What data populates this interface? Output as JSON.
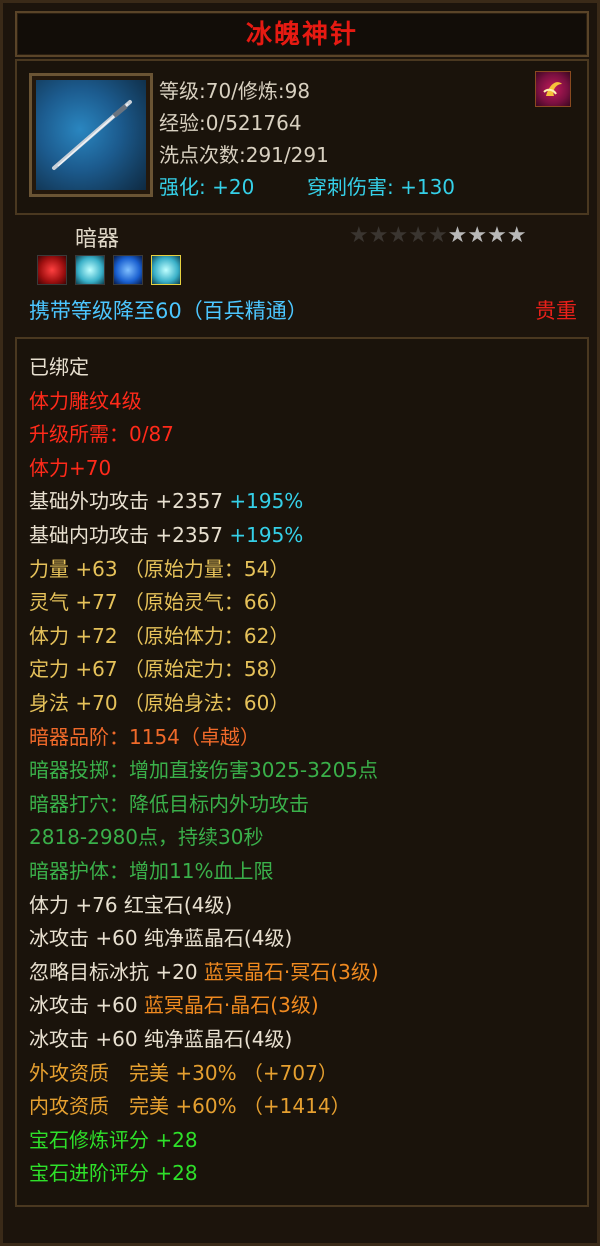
{
  "title": "冰魄神针",
  "info": {
    "level_line": "等级:70/修炼:98",
    "exp_line": "经验:0/521764",
    "wash_line": "洗点次数:291/291",
    "enhance_label": "强化: +20",
    "pierce_label": "穿刺伤害: +130"
  },
  "type_label": "暗器",
  "stars": {
    "total": 9,
    "lit": 4
  },
  "carry_text": "携带等级降至60（百兵精通）",
  "precious_text": "贵重",
  "attributes": [
    {
      "text": "已绑定",
      "color": "white"
    },
    {
      "text": "体力雕纹4级",
      "color": "red"
    },
    {
      "text": "升级所需：0/87",
      "color": "red"
    },
    {
      "text": "体力+70",
      "color": "red"
    },
    {
      "text": "基础外功攻击 +2357",
      "suffix": " +195%",
      "color": "white"
    },
    {
      "text": "基础内功攻击 +2357",
      "suffix": " +195%",
      "color": "white"
    },
    {
      "text": "力量 +63 （原始力量：54）",
      "color": "yellow"
    },
    {
      "text": "灵气 +77 （原始灵气：66）",
      "color": "yellow"
    },
    {
      "text": "体力 +72 （原始体力：62）",
      "color": "yellow"
    },
    {
      "text": "定力 +67 （原始定力：58）",
      "color": "yellow"
    },
    {
      "text": "身法 +70 （原始身法：60）",
      "color": "yellow"
    },
    {
      "text": "暗器品阶：1154（卓越）",
      "color": "orange"
    },
    {
      "text": "暗器投掷：增加直接伤害3025-3205点",
      "color": "green"
    },
    {
      "text": "暗器打穴：降低目标内外功攻击",
      "color": "green"
    },
    {
      "text": "2818-2980点，持续30秒",
      "color": "green"
    },
    {
      "text": "暗器护体：增加11%血上限",
      "color": "green"
    },
    {
      "text": "体力 +76 红宝石(4级)",
      "color": "white"
    },
    {
      "text": "冰攻击 +60 纯净蓝晶石(4级)",
      "color": "white"
    },
    {
      "text": "忽略目标冰抗 +20",
      "suffix": " 蓝冥晶石·冥石(3级)",
      "color": "white"
    },
    {
      "text": "冰攻击 +60",
      "suffix": " 蓝冥晶石·晶石(3级)",
      "color": "white"
    },
    {
      "text": "冰攻击 +60 纯净蓝晶石(4级)",
      "color": "white"
    },
    {
      "text": "外攻资质　完美 +30% （+707）",
      "color": "gold"
    },
    {
      "text": "内攻资质　完美 +60% （+1414）",
      "color": "gold"
    },
    {
      "text": "宝石修炼评分 +28",
      "color": "brightgreen"
    },
    {
      "text": "宝石进阶评分 +28",
      "color": "brightgreen"
    }
  ],
  "colors": {
    "title": "#e61a12",
    "cyan": "#35d0e8",
    "carry": "#4cc6ff",
    "precious": "#e8201a"
  }
}
